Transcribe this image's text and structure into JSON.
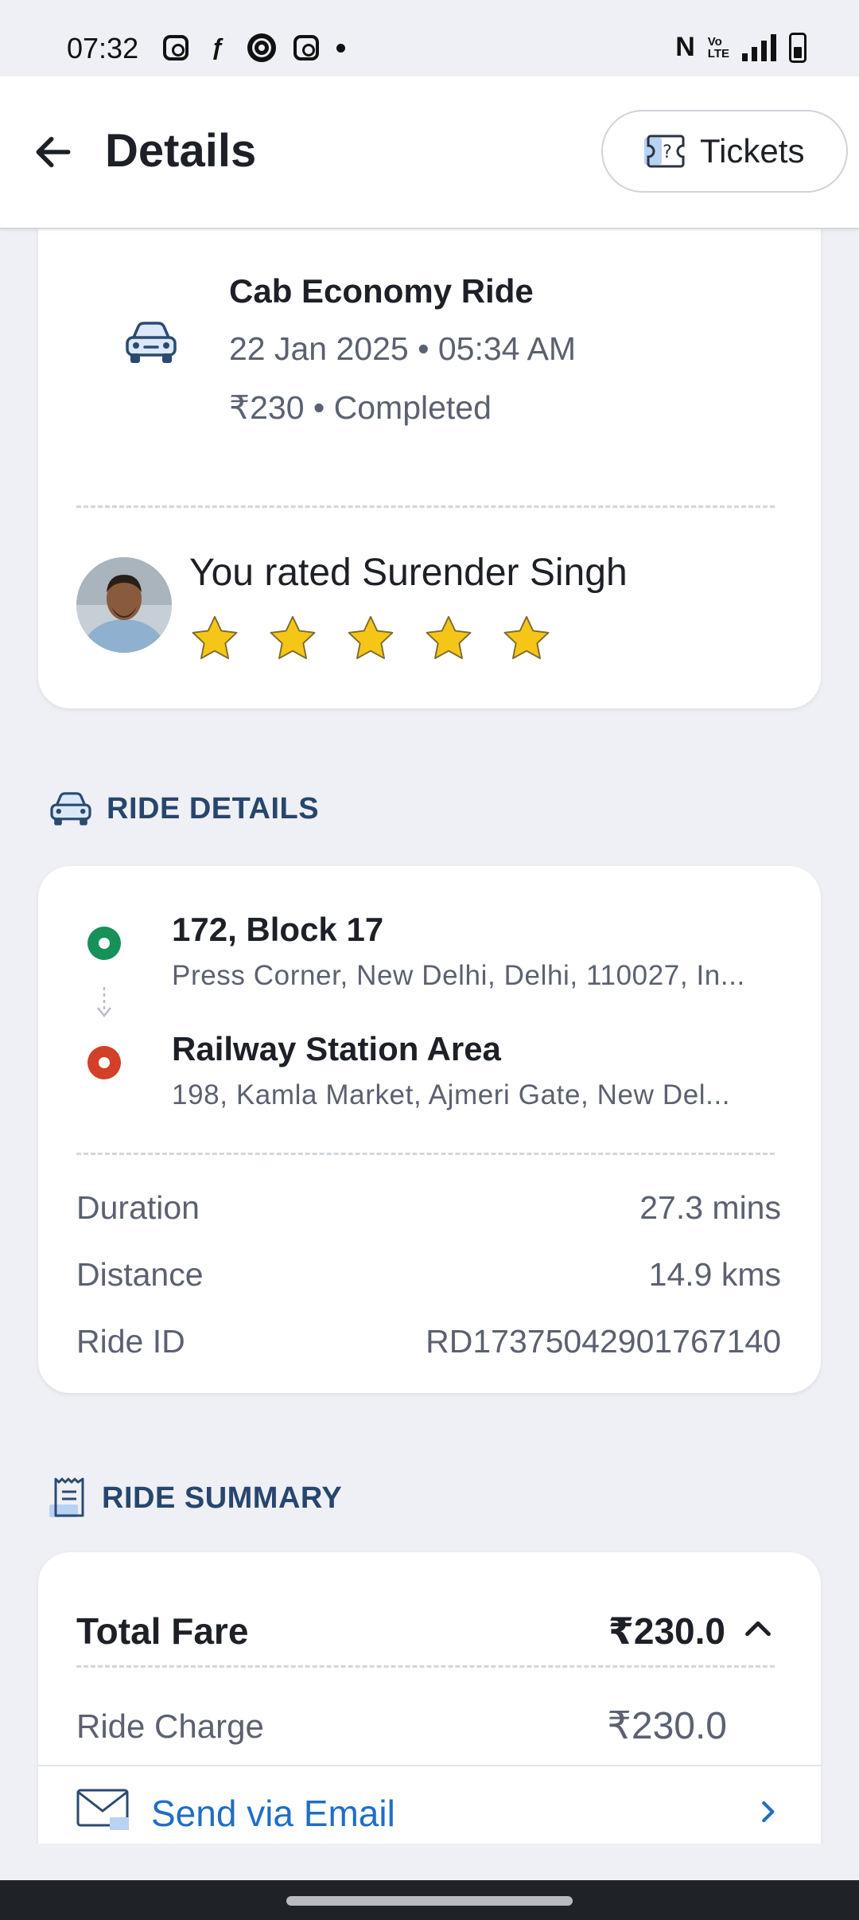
{
  "status_bar": {
    "time": "07:32"
  },
  "header": {
    "title": "Details",
    "tickets_label": "Tickets"
  },
  "ride": {
    "type": "Cab Economy Ride",
    "datetime": "22 Jan 2025 • 05:34 AM",
    "fare_status": "₹230 • Completed",
    "rating_text": "You rated Surender Singh",
    "rating_value": 5,
    "rating_max": 5
  },
  "ride_details": {
    "section_title": "RIDE DETAILS",
    "pickup": {
      "title": "172, Block 17",
      "address": "Press Corner, New Delhi, Delhi, 110027, In..."
    },
    "drop": {
      "title": "Railway Station Area",
      "address": "198, Kamla Market, Ajmeri Gate, New Del..."
    },
    "rows": [
      {
        "label": "Duration",
        "value": "27.3 mins"
      },
      {
        "label": "Distance",
        "value": "14.9 kms"
      },
      {
        "label": "Ride ID",
        "value": "RD17375042901767140"
      }
    ]
  },
  "ride_summary": {
    "section_title": "RIDE SUMMARY",
    "total_label": "Total Fare",
    "total_value": "₹230.0",
    "charge_label": "Ride Charge",
    "charge_value": "₹230.0",
    "email_label": "Send via Email"
  },
  "colors": {
    "pickup_dot": "#17915a",
    "drop_dot": "#d2402a",
    "section_title": "#26466e",
    "link": "#1f6ec4",
    "star": "#f5c518"
  }
}
